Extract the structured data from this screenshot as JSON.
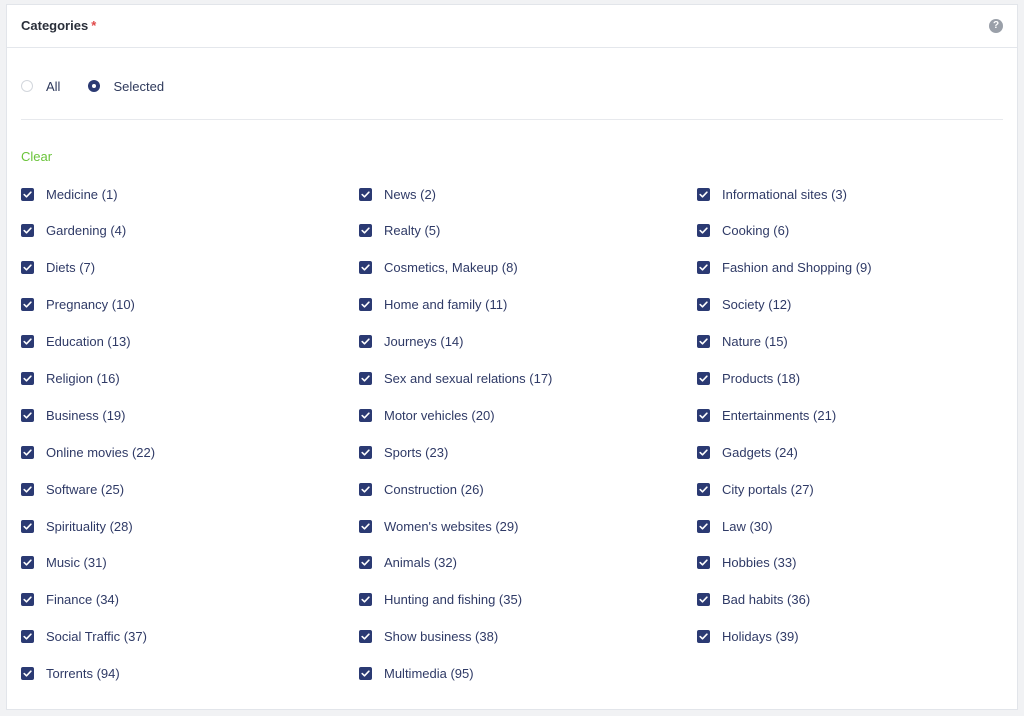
{
  "header": {
    "title": "Categories",
    "required_mark": "*",
    "help_icon": "question-circle-icon",
    "help_glyph": "?"
  },
  "scope": {
    "options": [
      {
        "label": "All",
        "checked": false
      },
      {
        "label": "Selected",
        "checked": true
      }
    ]
  },
  "clear_label": "Clear",
  "colors": {
    "accent": "#2b3a73",
    "clear_link": "#6ac43a",
    "required": "#e04848"
  },
  "categories": [
    {
      "label": "Medicine (1)",
      "checked": true
    },
    {
      "label": "News (2)",
      "checked": true
    },
    {
      "label": "Informational sites (3)",
      "checked": true
    },
    {
      "label": "Gardening (4)",
      "checked": true
    },
    {
      "label": "Realty (5)",
      "checked": true
    },
    {
      "label": "Cooking (6)",
      "checked": true
    },
    {
      "label": "Diets (7)",
      "checked": true
    },
    {
      "label": "Cosmetics, Makeup (8)",
      "checked": true
    },
    {
      "label": "Fashion and Shopping (9)",
      "checked": true
    },
    {
      "label": "Pregnancy (10)",
      "checked": true
    },
    {
      "label": "Home and family (11)",
      "checked": true
    },
    {
      "label": "Society (12)",
      "checked": true
    },
    {
      "label": "Education (13)",
      "checked": true
    },
    {
      "label": "Journeys (14)",
      "checked": true
    },
    {
      "label": "Nature (15)",
      "checked": true
    },
    {
      "label": "Religion (16)",
      "checked": true
    },
    {
      "label": "Sex and sexual relations (17)",
      "checked": true
    },
    {
      "label": "Products (18)",
      "checked": true
    },
    {
      "label": "Business (19)",
      "checked": true
    },
    {
      "label": "Motor vehicles (20)",
      "checked": true
    },
    {
      "label": "Entertainments (21)",
      "checked": true
    },
    {
      "label": "Online movies (22)",
      "checked": true
    },
    {
      "label": "Sports (23)",
      "checked": true
    },
    {
      "label": "Gadgets (24)",
      "checked": true
    },
    {
      "label": "Software (25)",
      "checked": true
    },
    {
      "label": "Construction (26)",
      "checked": true
    },
    {
      "label": "City portals (27)",
      "checked": true
    },
    {
      "label": "Spirituality (28)",
      "checked": true
    },
    {
      "label": "Women's websites (29)",
      "checked": true
    },
    {
      "label": "Law (30)",
      "checked": true
    },
    {
      "label": "Music (31)",
      "checked": true
    },
    {
      "label": "Animals (32)",
      "checked": true
    },
    {
      "label": "Hobbies (33)",
      "checked": true
    },
    {
      "label": "Finance (34)",
      "checked": true
    },
    {
      "label": "Hunting and fishing (35)",
      "checked": true
    },
    {
      "label": "Bad habits (36)",
      "checked": true
    },
    {
      "label": "Social Traffic (37)",
      "checked": true
    },
    {
      "label": "Show business (38)",
      "checked": true
    },
    {
      "label": "Holidays (39)",
      "checked": true
    },
    {
      "label": "Torrents (94)",
      "checked": true
    },
    {
      "label": "Multimedia (95)",
      "checked": true
    }
  ]
}
